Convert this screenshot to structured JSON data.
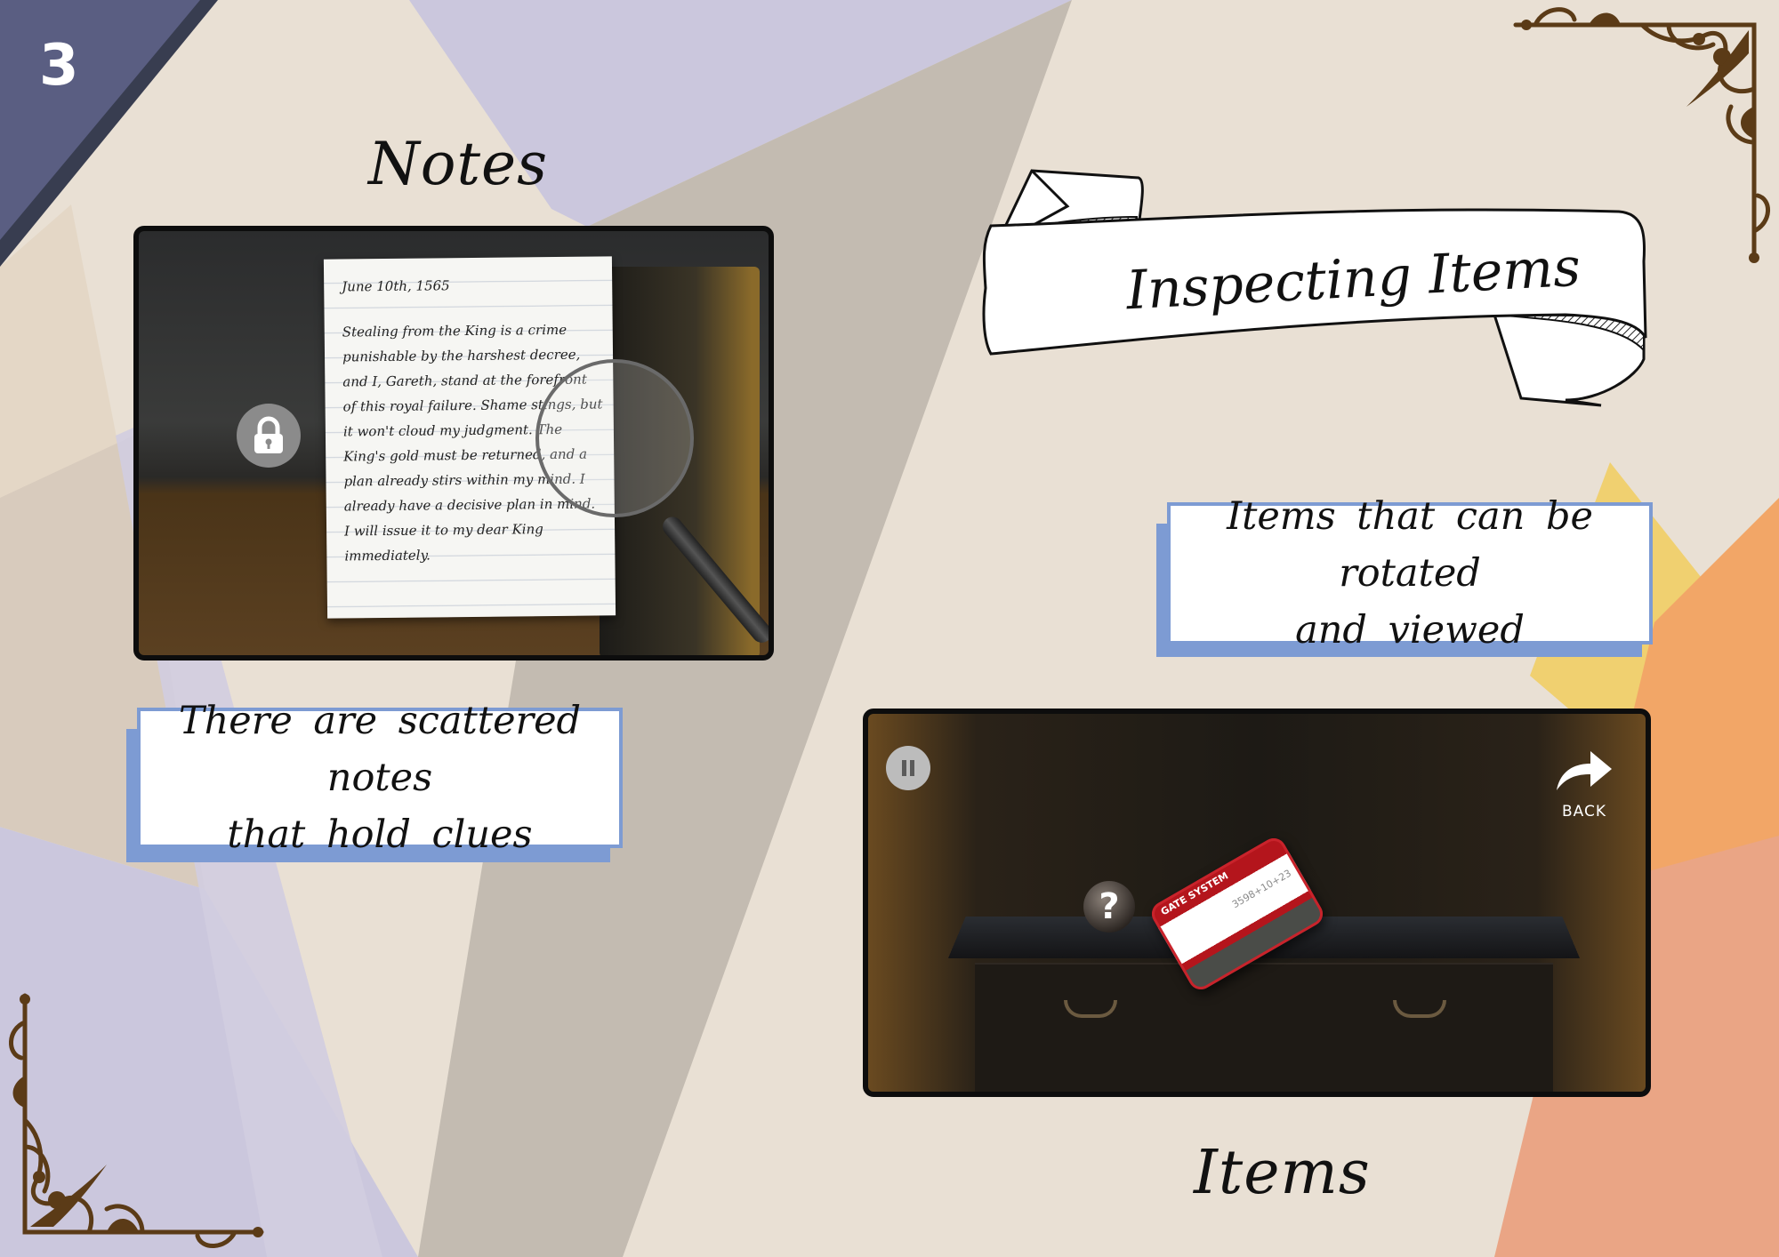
{
  "page": {
    "number": "3"
  },
  "headings": {
    "notes": "Notes",
    "items": "Items"
  },
  "banner": {
    "title": "Inspecting Items"
  },
  "captions": {
    "notes_line1": "There are scattered notes",
    "notes_line2": "that hold clues",
    "items_line1": "Items that can be rotated",
    "items_line2": "and viewed"
  },
  "note_screenshot": {
    "date": "June 10th, 1565",
    "body": "Stealing from the King is a crime punishable by the harshest decree, and I, Gareth, stand at the forefront of this royal failure. Shame stings, but it won't cloud my judgment. The King's gold must be returned, and a plan already stirs within my mind. I already have a decisive plan in mind. I will issue it to my dear King immediately.",
    "icons": [
      "lock-icon",
      "magnifying-glass-icon"
    ]
  },
  "item_screenshot": {
    "back_label": "BACK",
    "hint_symbol": "?",
    "card_title": "GATE SYSTEM",
    "card_code": "3598+10+23",
    "icons": [
      "pause-icon",
      "back-arrow-icon",
      "question-icon"
    ]
  },
  "colors": {
    "background": "#e9e0d4",
    "lavender": "#c9c6dd",
    "taupe": "#c2bab0",
    "navy_corner": "#5a5e82",
    "caption_border": "#7d9bd3",
    "orange": "#f2a667",
    "yellow": "#f1cf63",
    "salmon": "#eaa585",
    "ornament": "#5b3b17"
  }
}
